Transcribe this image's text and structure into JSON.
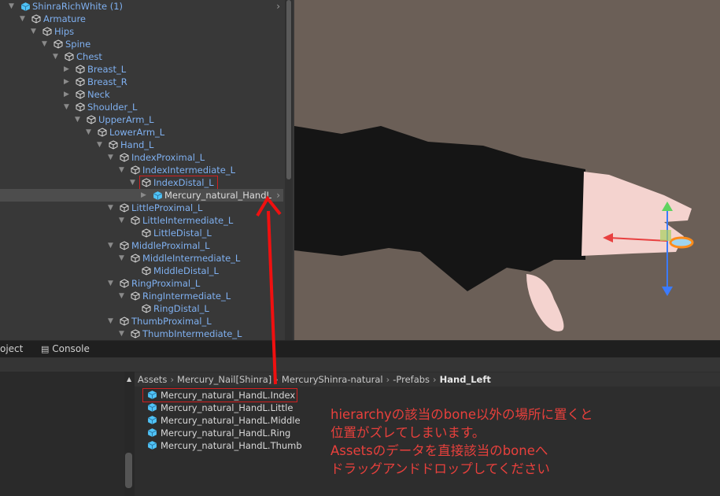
{
  "hierarchy": {
    "rows": [
      {
        "label": "ShinraRichWhite (1)",
        "level": 0,
        "arrow": "expanded",
        "icon": "prefab"
      },
      {
        "label": "Armature",
        "level": 1,
        "arrow": "expanded",
        "icon": "gameobject"
      },
      {
        "label": "Hips",
        "level": 2,
        "arrow": "expanded",
        "icon": "gameobject"
      },
      {
        "label": "Spine",
        "level": 3,
        "arrow": "expanded",
        "icon": "gameobject"
      },
      {
        "label": "Chest",
        "level": 4,
        "arrow": "expanded",
        "icon": "gameobject"
      },
      {
        "label": "Breast_L",
        "level": 5,
        "arrow": "collapsed",
        "icon": "gameobject"
      },
      {
        "label": "Breast_R",
        "level": 5,
        "arrow": "collapsed",
        "icon": "gameobject"
      },
      {
        "label": "Neck",
        "level": 5,
        "arrow": "collapsed",
        "icon": "gameobject"
      },
      {
        "label": "Shoulder_L",
        "level": 5,
        "arrow": "expanded",
        "icon": "gameobject"
      },
      {
        "label": "UpperArm_L",
        "level": 6,
        "arrow": "expanded",
        "icon": "gameobject"
      },
      {
        "label": "LowerArm_L",
        "level": 7,
        "arrow": "expanded",
        "icon": "gameobject"
      },
      {
        "label": "Hand_L",
        "level": 8,
        "arrow": "expanded",
        "icon": "gameobject"
      },
      {
        "label": "IndexProximal_L",
        "level": 9,
        "arrow": "expanded",
        "icon": "gameobject"
      },
      {
        "label": "IndexIntermediate_L",
        "level": 10,
        "arrow": "expanded",
        "icon": "gameobject"
      },
      {
        "label": "IndexDistal_L",
        "level": 11,
        "arrow": "expanded",
        "icon": "gameobject",
        "highlight": true
      },
      {
        "label": "Mercury_natural_HandL",
        "level": 12,
        "arrow": "collapsed",
        "icon": "prefab-added",
        "selected": true
      },
      {
        "label": "LittleProximal_L",
        "level": 9,
        "arrow": "expanded",
        "icon": "gameobject"
      },
      {
        "label": "LittleIntermediate_L",
        "level": 10,
        "arrow": "expanded",
        "icon": "gameobject"
      },
      {
        "label": "LittleDistal_L",
        "level": 11,
        "arrow": "none",
        "icon": "gameobject"
      },
      {
        "label": "MiddleProximal_L",
        "level": 9,
        "arrow": "expanded",
        "icon": "gameobject"
      },
      {
        "label": "MiddleIntermediate_L",
        "level": 10,
        "arrow": "expanded",
        "icon": "gameobject"
      },
      {
        "label": "MiddleDistal_L",
        "level": 11,
        "arrow": "none",
        "icon": "gameobject"
      },
      {
        "label": "RingProximal_L",
        "level": 9,
        "arrow": "expanded",
        "icon": "gameobject"
      },
      {
        "label": "RingIntermediate_L",
        "level": 10,
        "arrow": "expanded",
        "icon": "gameobject"
      },
      {
        "label": "RingDistal_L",
        "level": 11,
        "arrow": "none",
        "icon": "gameobject"
      },
      {
        "label": "ThumbProximal_L",
        "level": 9,
        "arrow": "expanded",
        "icon": "gameobject"
      },
      {
        "label": "ThumbIntermediate_L",
        "level": 10,
        "arrow": "expanded",
        "icon": "gameobject"
      }
    ]
  },
  "tabs": {
    "project": "oject",
    "console": "Console"
  },
  "breadcrumb": [
    "Assets",
    "Mercury_Nail[Shinra]",
    "MercuryShinra-natural",
    "-Prefabs",
    "Hand_Left"
  ],
  "assets": [
    "Mercury_natural_HandL.Index",
    "Mercury_natural_HandL.Little",
    "Mercury_natural_HandL.Middle",
    "Mercury_natural_HandL.Ring",
    "Mercury_natural_HandL.Thumb"
  ],
  "annotation": {
    "lines": [
      "hierarchyの該当のbone以外の場所に置くと",
      "位置がズレてしまいます。",
      "Assetsのデータを直接該当のboneへ",
      "ドラッグアンドドロップしてください"
    ],
    "color": "#e8403c"
  },
  "colors": {
    "hierarchy_text": "#7fb0f0",
    "prefab_icon": "#4fc3f7",
    "scene_bg": "#6b5f57"
  }
}
